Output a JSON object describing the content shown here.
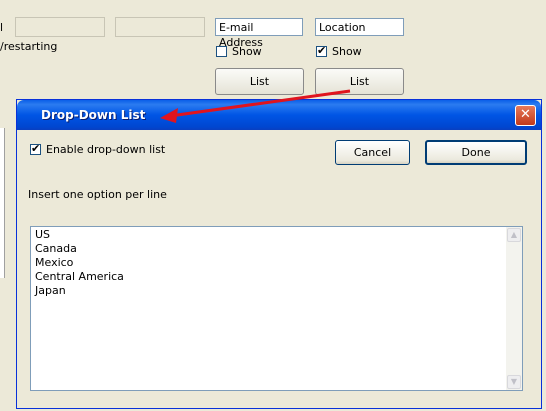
{
  "background": {
    "partial_label": "l",
    "email_field_value": "E-mail Address",
    "location_field_value": "Location",
    "restart_text_fragment": "/restarting",
    "show_label_email": "Show",
    "show_label_location": "Show",
    "list_button_email": "List",
    "list_button_location": "List",
    "show_email_checked": false,
    "show_location_checked": true
  },
  "dialog": {
    "title": "Drop-Down List",
    "close_icon": "✕",
    "enable_label": "Enable drop-down list",
    "enable_checked": true,
    "cancel_label": "Cancel",
    "done_label": "Done",
    "instruction": "Insert one option per line",
    "options": [
      "US",
      "Canada",
      "Mexico",
      "Central America",
      "Japan"
    ]
  },
  "colors": {
    "titlebar": "#0055e5",
    "annotation_arrow": "#e0141e"
  }
}
